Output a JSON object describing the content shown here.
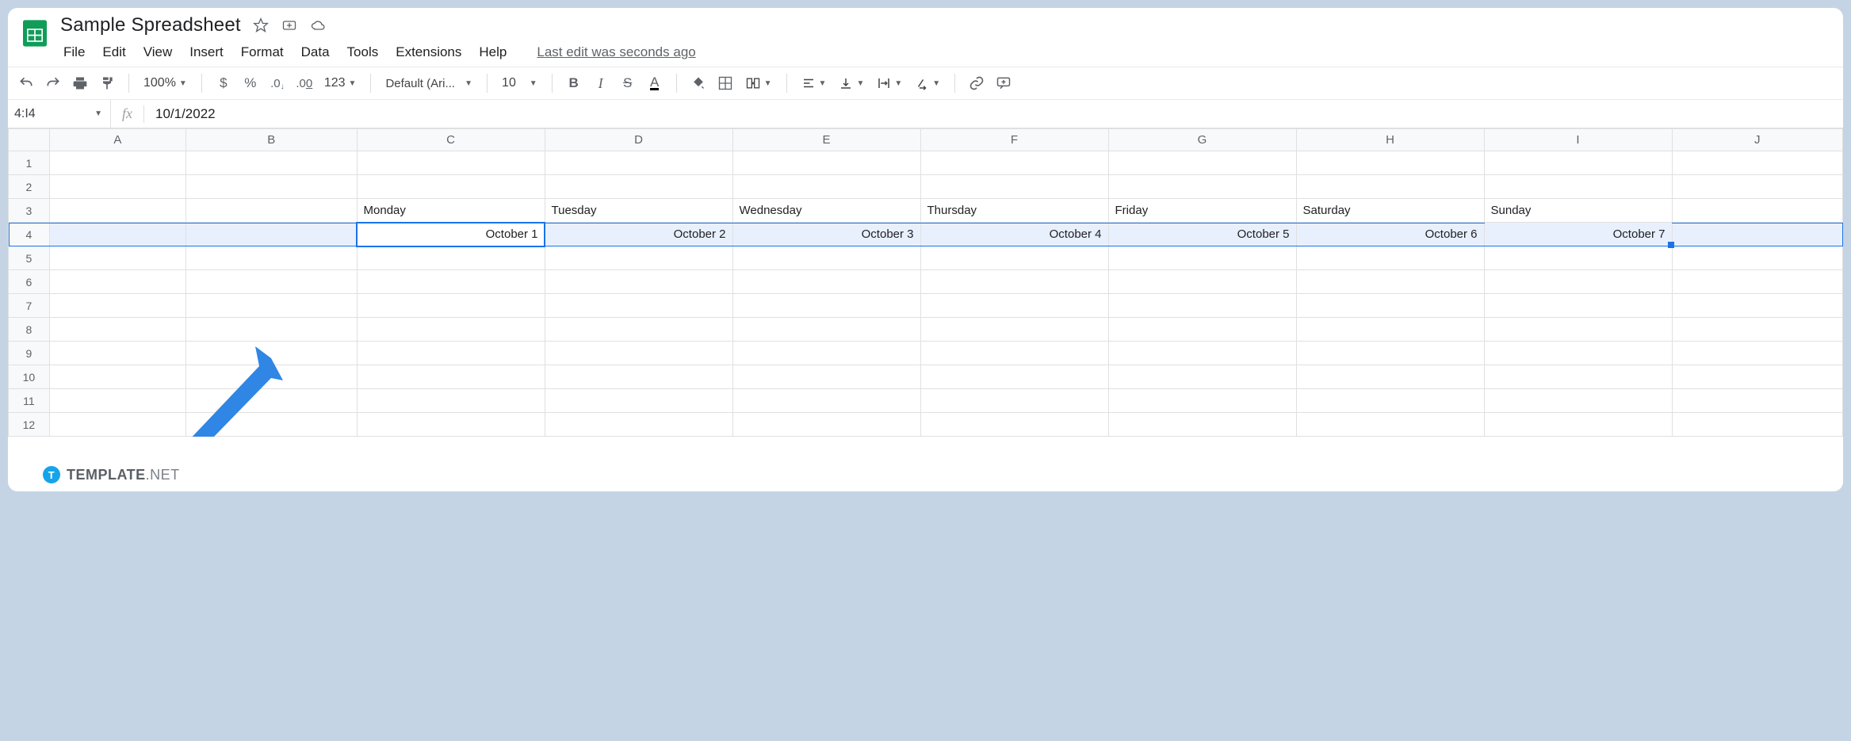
{
  "doc": {
    "title": "Sample Spreadsheet",
    "last_edit": "Last edit was seconds ago"
  },
  "menus": [
    "File",
    "Edit",
    "View",
    "Insert",
    "Format",
    "Data",
    "Tools",
    "Extensions",
    "Help"
  ],
  "toolbar": {
    "zoom": "100%",
    "currency": "$",
    "percent": "%",
    "dec_dec": ".0",
    "inc_dec": ".00",
    "more_fmt": "123",
    "font": "Default (Ari...",
    "font_size": "10"
  },
  "name_box": "4:I4",
  "formula_bar": "10/1/2022",
  "columns": [
    "A",
    "B",
    "C",
    "D",
    "E",
    "F",
    "G",
    "H",
    "I",
    "J"
  ],
  "row_count": 12,
  "selection": {
    "row": 4,
    "start_col_index": 2,
    "end_col_index": 8
  },
  "cells": {
    "row3": {
      "C": "Monday",
      "D": "Tuesday",
      "E": "Wednesday",
      "F": "Thursday",
      "G": "Friday",
      "H": "Saturday",
      "I": "Sunday"
    },
    "row4": {
      "C": "October 1",
      "D": "October 2",
      "E": "October 3",
      "F": "October 4",
      "G": "October 5",
      "H": "October 6",
      "I": "October 7"
    }
  },
  "watermark": {
    "brand": "TEMPLATE",
    "tld": ".NET"
  }
}
